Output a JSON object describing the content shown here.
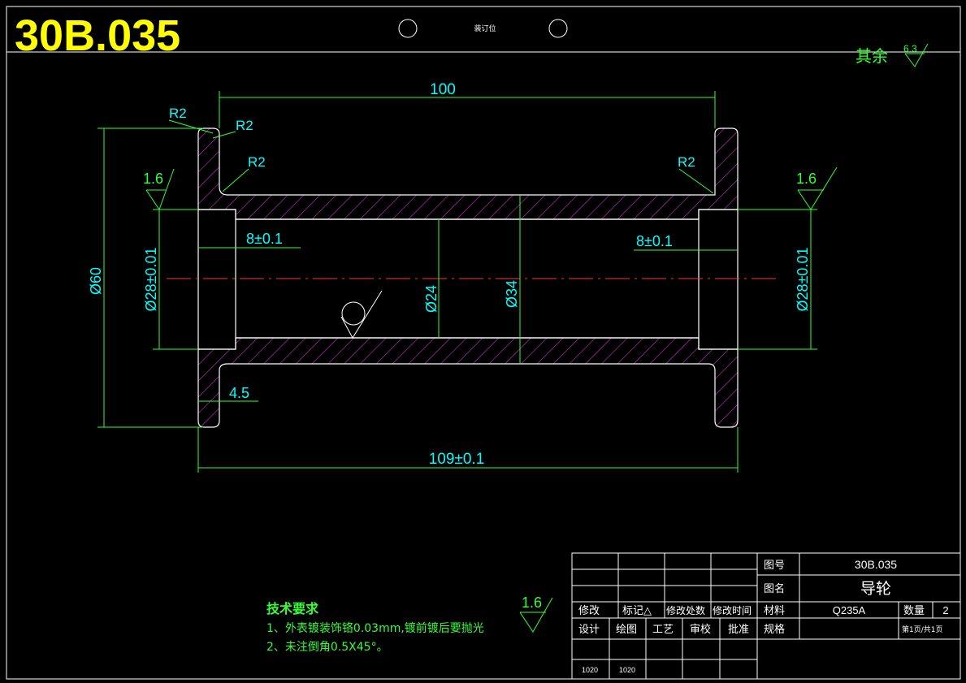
{
  "drawing_number_large": "30B.035",
  "binding_label": "装订位",
  "surface_rest": {
    "label": "其余",
    "value": "6.3"
  },
  "roughness_marks": [
    "1.6",
    "1.6",
    "1.6"
  ],
  "dimensions": {
    "top_length": "100",
    "overall_length": "109±0.1",
    "outer_diameter": "Ø60",
    "bore_left": "Ø28±0.01",
    "bore_right": "Ø28±0.01",
    "inner_diameter": "Ø24",
    "body_diameter": "Ø34",
    "bore_depth_left": "8±0.1",
    "bore_depth_right": "8±0.1",
    "flange_thickness": "4.5",
    "radii": [
      "R2",
      "R2",
      "R2",
      "R2"
    ]
  },
  "tech_requirements": {
    "title": "技术要求",
    "items": [
      "1、外表镀装饰铬0.03mm,镀前镀后要抛光",
      "2、未注倒角0.5X45°。"
    ]
  },
  "title_block": {
    "revision_headers": [
      "修改",
      "标记△",
      "修改处数",
      "修改时间"
    ],
    "role_headers": [
      "设计",
      "绘图",
      "工艺",
      "审校",
      "批准"
    ],
    "role_values": [
      "1020",
      "1020"
    ],
    "drawing_no_label": "图号",
    "drawing_no": "30B.035",
    "name_label": "图名",
    "name": "导轮",
    "material_label": "材料",
    "material": "Q235A",
    "qty_label": "数量",
    "qty": "2",
    "spec_label": "规格",
    "page": "第1页/共1页"
  }
}
